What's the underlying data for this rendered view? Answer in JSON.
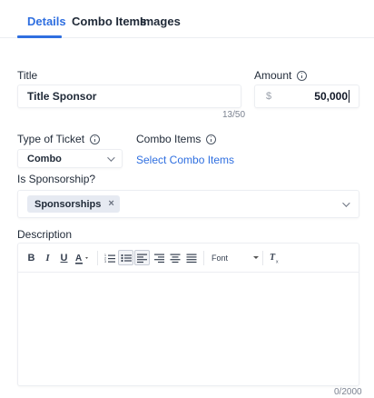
{
  "tabs": [
    {
      "label": "Details",
      "active": true
    },
    {
      "label": "Combo Items",
      "active": false
    },
    {
      "label": "Images",
      "active": false
    }
  ],
  "title_field": {
    "label": "Title",
    "value": "Title Sponsor",
    "counter": "13/50"
  },
  "amount_field": {
    "label": "Amount",
    "prefix": "$",
    "value": "50,000"
  },
  "ticket_type": {
    "label": "Type of Ticket",
    "value": "Combo"
  },
  "combo_items": {
    "label": "Combo Items",
    "link": "Select Combo Items"
  },
  "sponsorship": {
    "label": "Is Sponsorship?",
    "chip": "Sponsorships"
  },
  "description": {
    "label": "Description",
    "font_label": "Font",
    "counter": "0/2000",
    "toolbar_icons": [
      "bold-icon",
      "italic-icon",
      "underline-icon",
      "text-color-icon",
      "ordered-list-icon",
      "bullet-list-icon",
      "align-left-icon",
      "align-right-icon",
      "align-center-icon",
      "align-justify-icon",
      "clear-format-icon"
    ]
  },
  "colors": {
    "accent": "#2f6fe0",
    "text": "#1f2937",
    "muted": "#7b8290",
    "border": "#eceef2",
    "chip_bg": "#e6eaf2"
  }
}
